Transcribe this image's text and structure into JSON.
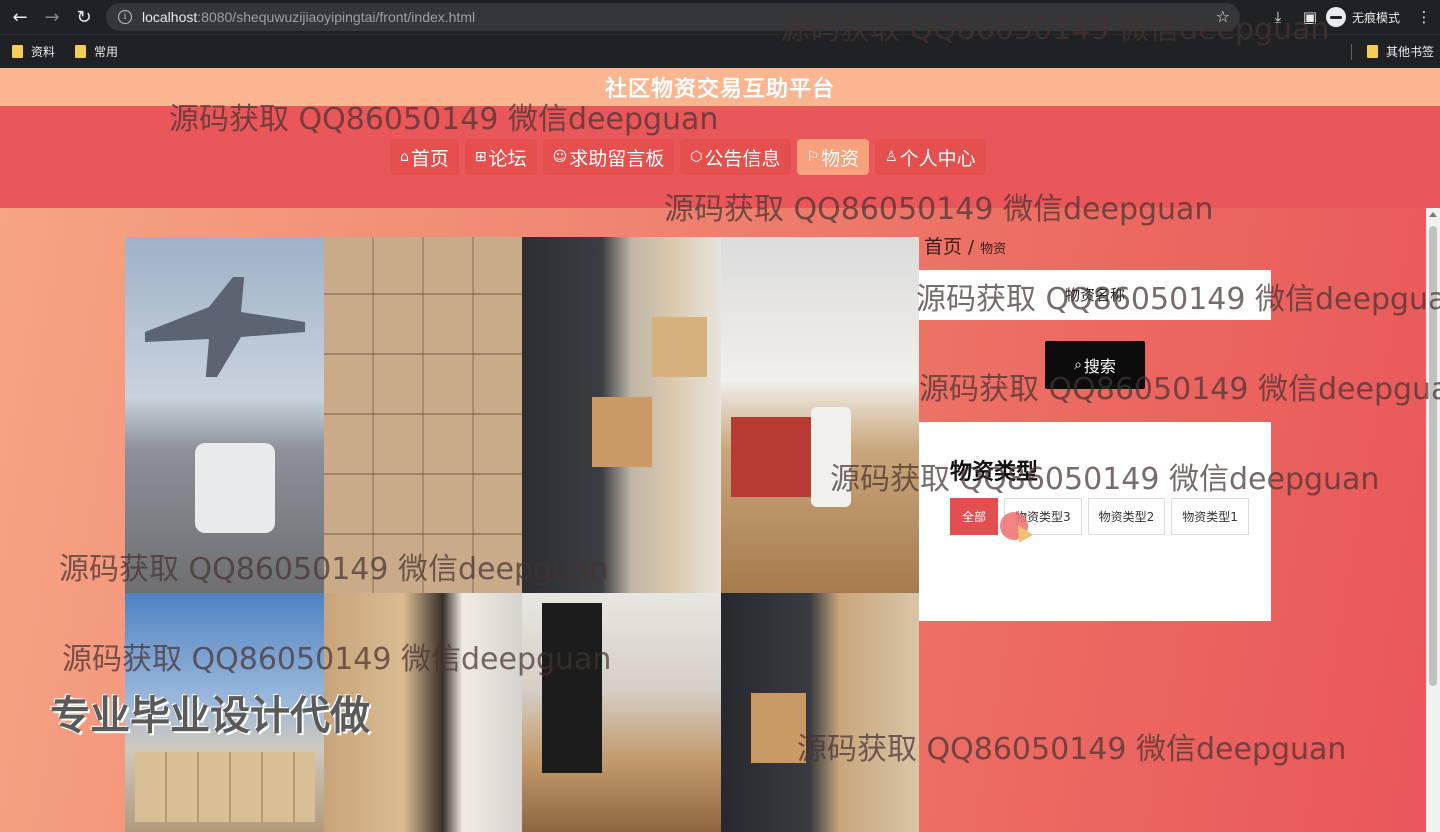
{
  "browser": {
    "url_host": "localhost",
    "url_path": ":8080/shequwuzijiaoyipingtai/front/index.html",
    "incognito_label": "无痕模式",
    "bookmarks": [
      "资料",
      "常用"
    ],
    "other_bookmarks": "其他书签"
  },
  "site": {
    "title": "社区物资交易互助平台"
  },
  "nav": {
    "items": [
      {
        "icon": "⌂",
        "label": "首页"
      },
      {
        "icon": "⊞",
        "label": "论坛"
      },
      {
        "icon": "☺",
        "label": "求助留言板"
      },
      {
        "icon": "⬡",
        "label": "公告信息"
      },
      {
        "icon": "⚐",
        "label": "物资"
      },
      {
        "icon": "♙",
        "label": "个人中心"
      }
    ],
    "active": "物资"
  },
  "breadcrumb": {
    "home": "首页",
    "separator": "/",
    "current": "物资"
  },
  "search": {
    "placeholder": "物资名称",
    "button_label": "搜索"
  },
  "category_panel": {
    "title": "物资类型",
    "tags": [
      "全部",
      "物资类型3",
      "物资类型2",
      "物资类型1"
    ],
    "active_tag": "全部"
  },
  "watermarks": {
    "text": "源码获取 QQ86050149 微信deepguan",
    "big_text": "专业毕业设计代做"
  },
  "colors": {
    "header_bg": "#fbb591",
    "navbar_bg": "#e9575a",
    "active_nav": "#f9a17c",
    "active_tag": "#e34f51",
    "search_button": "#0c0c0c"
  }
}
